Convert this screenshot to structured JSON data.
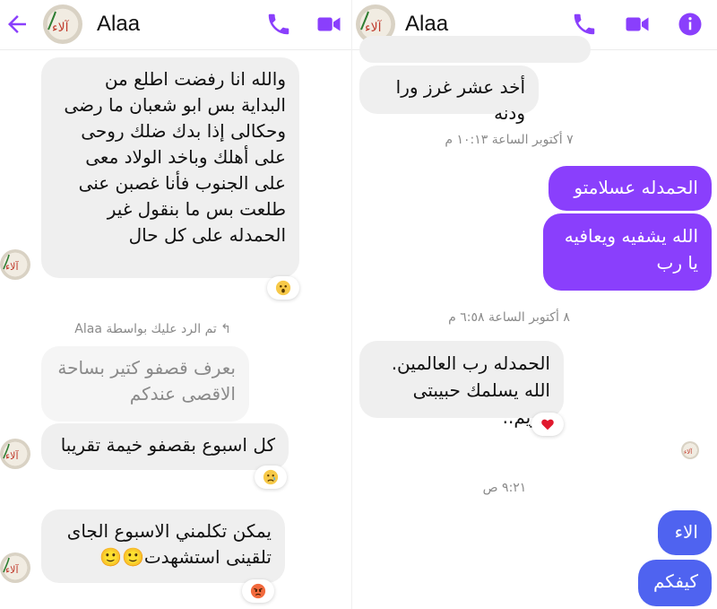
{
  "left": {
    "contact_name": "Alaa",
    "messages": [
      "والله انا رفضت اطلع من البداية بس ابو شعبان ما رضى وحكالى إذا بدك ضلك روحى على أهلك وباخد الولاد معى على الجنوب فأنا غصبن عنى طلعت بس ما بنقول غير الحمدله على كل حال",
      "بعرف قصفو كتير بساحة الاقصى عندكم",
      "كل اسبوع بقصفو خيمة تقريبا",
      "يمكن تكلمني الاسبوع الجاى تلقينى استشهدت🙂🙂"
    ],
    "reply_note": "تم الرد عليك بواسطة Alaa",
    "reactions": [
      "wow-emoji",
      "sad-emoji",
      "angry-emoji"
    ]
  },
  "right": {
    "contact_name": "Alaa",
    "messages": [
      "أخد عشر غرز ورا ودنه",
      "الحمدله عسلامتو",
      "الله يشفيه ويعافيه يا رب",
      "الحمدله رب العالمين. الله يسلمك حبيبتى مريم..",
      "الاء",
      "كيفكم"
    ],
    "timestamps": [
      "٧ أكتوبر الساعة ١٠:١٣ م",
      "٨ أكتوبر الساعة ٦:٥٨ م",
      "٩:٢١ ص"
    ],
    "reactions": [
      "heart-emoji"
    ]
  },
  "colors": {
    "accent": "#8a3ffc",
    "sent_blue": "#4f63f0",
    "received_bg": "#efefef"
  }
}
